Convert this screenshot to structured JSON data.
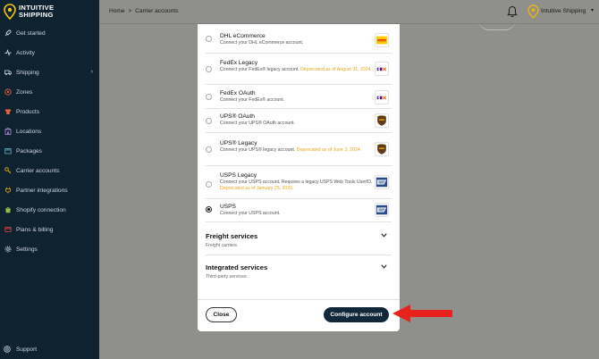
{
  "brand": {
    "logo_text": "INTUITIVE\nSHIPPING"
  },
  "sidebar": {
    "items": [
      {
        "label": "Get started",
        "icon": "rocket-icon"
      },
      {
        "label": "Activity",
        "icon": "activity-icon"
      },
      {
        "label": "Shipping",
        "icon": "truck-icon",
        "has_chevron": true
      },
      {
        "label": "Zones",
        "icon": "zones-icon"
      },
      {
        "label": "Products",
        "icon": "shirt-icon"
      },
      {
        "label": "Locations",
        "icon": "building-icon"
      },
      {
        "label": "Packages",
        "icon": "package-icon"
      },
      {
        "label": "Carrier accounts",
        "icon": "key-icon"
      },
      {
        "label": "Partner integrations",
        "icon": "plug-icon"
      },
      {
        "label": "Shopify connection",
        "icon": "shopping-bag-icon"
      },
      {
        "label": "Plans & billing",
        "icon": "billing-icon"
      },
      {
        "label": "Settings",
        "icon": "gear-icon"
      }
    ],
    "chevron": "›",
    "support_label": "Support"
  },
  "header": {
    "breadcrumb_home": "Home",
    "breadcrumb_separator": ">",
    "breadcrumb_current": "Carrier accounts",
    "account_name": "Intuitive Shipping",
    "account_caret": "▾"
  },
  "modal": {
    "carriers": [
      {
        "name": "DHL eCommerce",
        "desc": "Connect your DHL eCommerce account.",
        "deprecated": "",
        "logo": "dhl-logo",
        "selected": false
      },
      {
        "name": "FedEx Legacy",
        "desc": "Connect your FedEx® legacy account.",
        "deprecated": "Deprecated as of August 31, 2024.",
        "logo": "fedex-logo",
        "selected": false
      },
      {
        "name": "FedEx OAuth",
        "desc": "Connect your FedEx® account.",
        "deprecated": "",
        "logo": "fedex-logo",
        "selected": false
      },
      {
        "name": "UPS® OAuth",
        "desc": "Connect your UPS® OAuth account.",
        "deprecated": "",
        "logo": "ups-logo",
        "selected": false
      },
      {
        "name": "UPS® Legacy",
        "desc": "Connect your UPS® legacy account.",
        "deprecated": "Deprecated as of June 3, 2024.",
        "logo": "ups-logo",
        "selected": false
      },
      {
        "name": "USPS Legacy",
        "desc": "Connect your USPS account. Requires a legacy USPS Web Tools UserID.",
        "deprecated": "Deprecated as of January 25, 2026.",
        "logo": "usps-logo",
        "selected": false
      },
      {
        "name": "USPS",
        "desc": "Connect your USPS account.",
        "deprecated": "",
        "logo": "usps-logo",
        "selected": true
      }
    ],
    "sections": [
      {
        "title": "Freight services",
        "subtitle": "Freight carriers."
      },
      {
        "title": "Integrated services",
        "subtitle": "Third-party services."
      }
    ],
    "close_label": "Close",
    "configure_label": "Configure account"
  },
  "colors": {
    "sidebar_bg": "#0f2230",
    "primary_button": "#10283a",
    "deprecated_text": "#e6a81a",
    "arrow": "#e8231e",
    "dhl_yellow": "#ffcc00",
    "ups_brown": "#5b3a1d",
    "usps_blue": "#2b4a8c"
  }
}
